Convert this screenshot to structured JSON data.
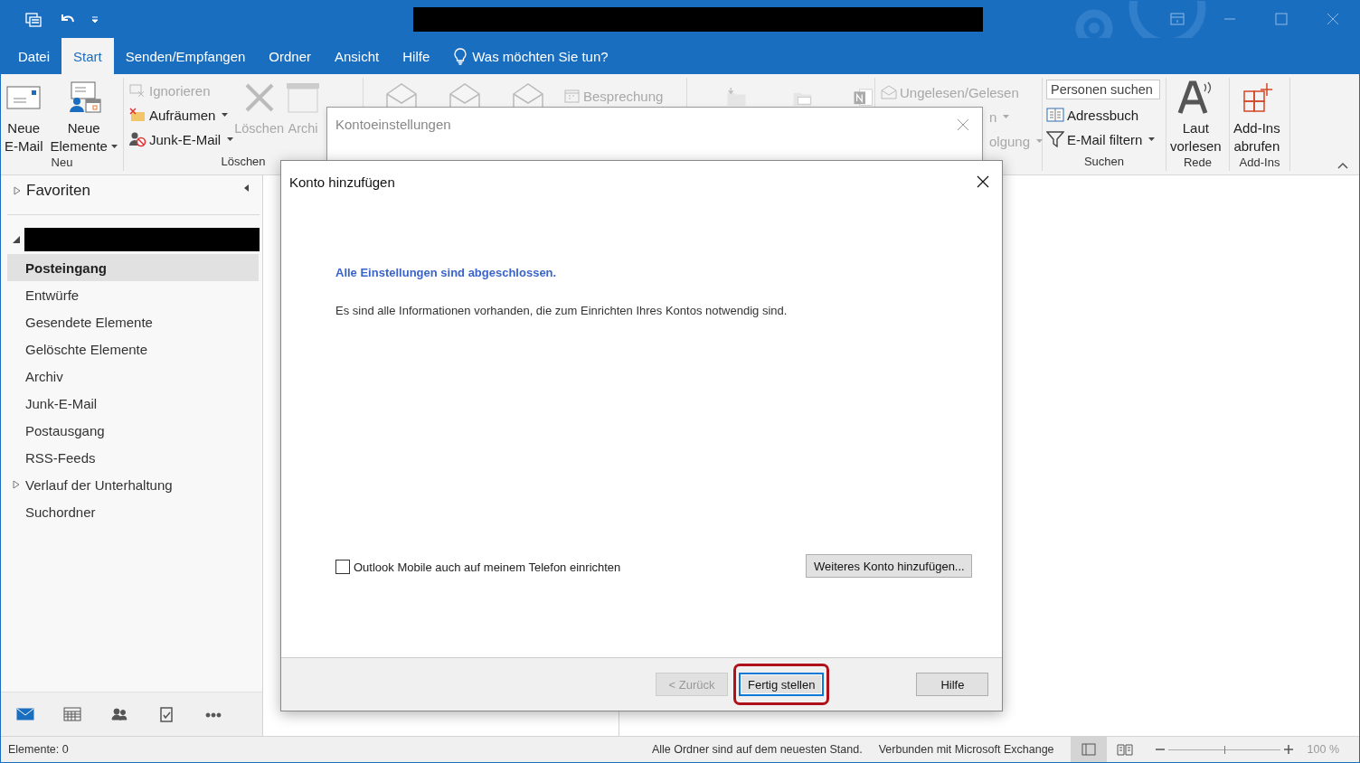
{
  "tabs": [
    {
      "label": "Datei",
      "selected": false
    },
    {
      "label": "Start",
      "selected": true
    },
    {
      "label": "Senden/Empfangen",
      "selected": false
    },
    {
      "label": "Ordner",
      "selected": false
    },
    {
      "label": "Ansicht",
      "selected": false
    },
    {
      "label": "Hilfe",
      "selected": false
    }
  ],
  "tell_me": "Was möchten Sie tun?",
  "ribbon": {
    "neu": {
      "label": "Neu",
      "items": [
        {
          "lines": [
            "Neue",
            "E-Mail"
          ],
          "dropdown": false
        },
        {
          "lines": [
            "Neue",
            "Elemente"
          ],
          "dropdown": true
        }
      ]
    },
    "loeschen": {
      "label": "Löschen",
      "small": [
        {
          "label": "Ignorieren",
          "disabled": true,
          "dropdown": false
        },
        {
          "label": "Aufräumen",
          "disabled": false,
          "dropdown": true
        },
        {
          "label": "Junk-E-Mail",
          "disabled": false,
          "dropdown": true
        }
      ],
      "large": [
        {
          "label": "Löschen",
          "disabled": true
        },
        {
          "label": "Archi",
          "disabled": true
        }
      ]
    },
    "antworten": {
      "meeting": {
        "label": "Besprechung",
        "disabled": true
      }
    },
    "kategorien": {
      "items": [
        {
          "label": "Ungelesen/Gelesen",
          "disabled": true,
          "dropdown": false
        },
        {
          "label": "n",
          "disabled": true,
          "dropdown": true
        },
        {
          "label": "olgung",
          "disabled": true,
          "dropdown": true
        }
      ]
    },
    "suchen": {
      "label": "Suchen",
      "search": {
        "placeholder": "Personen suchen"
      },
      "items": [
        {
          "label": "Adressbuch",
          "dropdown": false
        },
        {
          "label": "E-Mail filtern",
          "dropdown": true
        }
      ]
    },
    "rede": {
      "label": "Rede",
      "button": {
        "lines": [
          "Laut",
          "vorlesen"
        ]
      }
    },
    "addins": {
      "label": "Add-Ins",
      "button": {
        "lines": [
          "Add-Ins",
          "abrufen"
        ]
      }
    }
  },
  "nav": {
    "favorites": {
      "label": "Favoriten",
      "expanded": false
    },
    "account": {
      "expanded": true,
      "children": [
        {
          "label": "Posteingang",
          "selected": true,
          "has_children": false
        },
        {
          "label": "Entwürfe",
          "selected": false,
          "has_children": false
        },
        {
          "label": "Gesendete Elemente",
          "selected": false,
          "has_children": false
        },
        {
          "label": "Gelöschte Elemente",
          "selected": false,
          "has_children": false
        },
        {
          "label": "Archiv",
          "selected": false,
          "has_children": false
        },
        {
          "label": "Junk-E-Mail",
          "selected": false,
          "has_children": false
        },
        {
          "label": "Postausgang",
          "selected": false,
          "has_children": false
        },
        {
          "label": "RSS-Feeds",
          "selected": false,
          "has_children": false
        },
        {
          "label": "Verlauf der Unterhaltung",
          "selected": false,
          "has_children": true
        },
        {
          "label": "Suchordner",
          "selected": false,
          "has_children": false
        }
      ]
    },
    "modules": [
      {
        "selected": true
      },
      {
        "selected": false
      },
      {
        "selected": false
      },
      {
        "selected": false
      },
      {
        "selected": false
      }
    ]
  },
  "back_dialog": {
    "title": "Kontoeinstellungen"
  },
  "dialog": {
    "title": "Konto hinzufügen",
    "heading": "Alle Einstellungen sind abgeschlossen.",
    "message": "Es sind alle Informationen vorhanden, die zum Einrichten Ihres Kontos notwendig sind.",
    "mobile_checkbox": {
      "label": "Outlook Mobile auch auf meinem Telefon einrichten",
      "checked": false
    },
    "add_account_button": "Weiteres Konto hinzufügen...",
    "buttons": [
      {
        "label": "< Zurück",
        "disabled": true,
        "default": false,
        "highlighted": false
      },
      {
        "label": "Fertig stellen",
        "disabled": false,
        "default": true,
        "highlighted": true
      },
      {
        "label": "Hilfe",
        "disabled": false,
        "default": false,
        "highlighted": false
      }
    ]
  },
  "status_bar": {
    "items_count": "Elemente: 0",
    "sync_status": "Alle Ordner sind auf dem neuesten Stand.",
    "connection": "Verbunden mit Microsoft Exchange",
    "views": [
      {
        "selected": true
      },
      {
        "selected": false
      }
    ],
    "zoom": {
      "level": 0.5,
      "reading": "100 %"
    }
  }
}
